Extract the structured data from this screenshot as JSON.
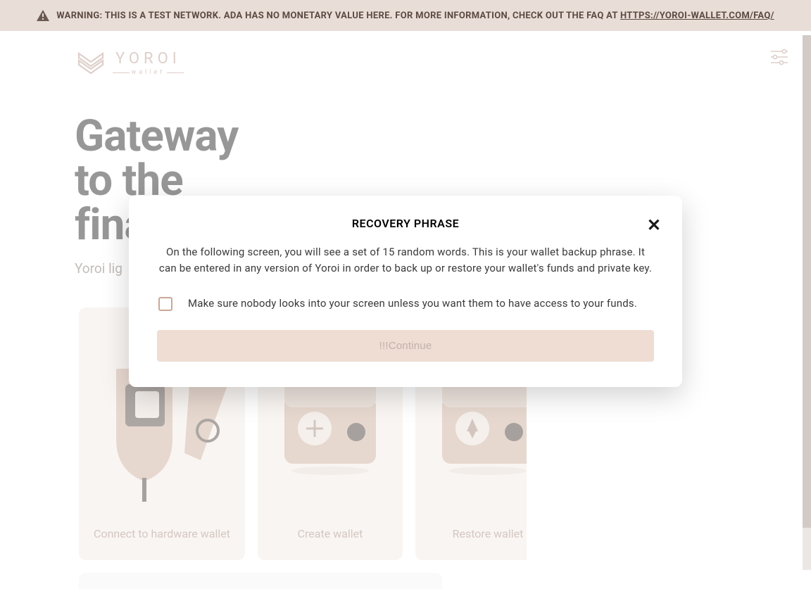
{
  "warning": {
    "text": "WARNING: THIS IS A TEST NETWORK. ADA HAS NO MONETARY VALUE HERE. FOR MORE INFORMATION, CHECK OUT THE FAQ AT ",
    "link_text": "HTTPS://YOROI-WALLET.COM/FAQ/"
  },
  "brand": {
    "name": "YOROI",
    "sub": "wallet"
  },
  "hero": {
    "title_line1": "Gateway",
    "title_line2": "to the",
    "title_line3": "fina",
    "subtitle": "Yoroi lig"
  },
  "cards": {
    "hardware": "Connect to hardware wallet",
    "create": "Create wallet",
    "restore": "Restore wallet"
  },
  "modal": {
    "title": "RECOVERY PHRASE",
    "body": "On the following screen, you will see a set of 15 random words. This is your wallet backup phrase. It can be entered in any version of Yoroi in order to back up or restore your wallet's funds and private key.",
    "checkbox_label": "Make sure nobody looks into your screen unless you want them to have access to your funds.",
    "button": "!!!Continue"
  },
  "colors": {
    "accent": "#b59688",
    "warn_bg": "#e9ddd7",
    "card_bg": "#f2e8e2"
  }
}
